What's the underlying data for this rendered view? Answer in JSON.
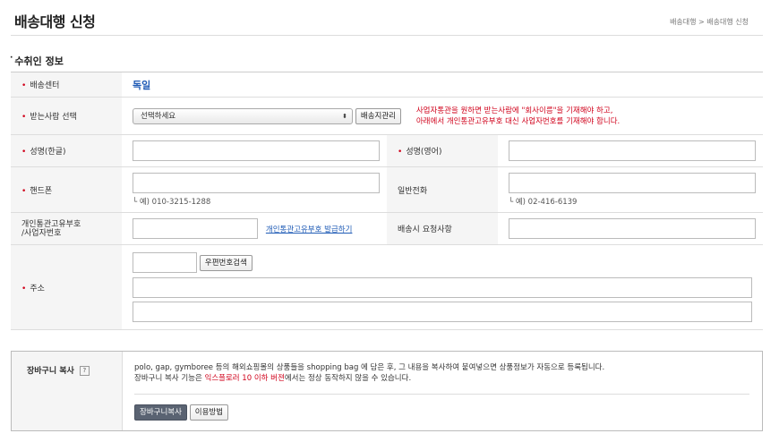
{
  "header": {
    "title": "배송대행 신청",
    "breadcrumb": "배송대행 > 배송대행 신청"
  },
  "recipient": {
    "section_title": "수취인 정보",
    "center_label": "배송센터",
    "center_value": "독일",
    "receiver_label": "받는사람 선택",
    "receiver_select_value": "선택하세요",
    "manage_button": "배송지관리",
    "warning_line1": "사업자통관을 원하면 받는사람에 \"회사이름\"을 기재해야 하고,",
    "warning_line2": "아래에서 개인통관고유부호 대신 사업자번호를 기재해야 합니다.",
    "name_kr_label": "성명(한글)",
    "name_kr_value": "",
    "name_en_label": "성명(영어)",
    "name_en_value": "",
    "mobile_label": "핸드폰",
    "mobile_value": "",
    "mobile_hint": "└ 예) 010-3215-1288",
    "phone_label": "일반전화",
    "phone_value": "",
    "phone_hint": "└ 예) 02-416-6139",
    "customs_label_line1": "개인통관고유부호",
    "customs_label_line2": "/사업자번호",
    "customs_value": "",
    "customs_link": "개인통관고유부호 발급하기",
    "request_label": "배송시 요청사항",
    "request_value": "",
    "address_label": "주소",
    "zipcode_value": "",
    "zipcode_button": "우편번호검색",
    "address1_value": "",
    "address2_value": ""
  },
  "cart_copy": {
    "label": "장바구니 복사",
    "help_icon_text": "?",
    "desc_line1": "polo, gap, gymboree 등의 해외쇼핑몰의 상품들을 shopping bag 에 담은 후, 그 내용을 복사하여 붙여넣으면 상품정보가 자동으로 등록됩니다.",
    "desc_line2_a": "장바구니 복사 기능은 ",
    "desc_line2_red": "익스플로러 10 이하 버젼",
    "desc_line2_b": "에서는 정상 동작하지 않을 수 있습니다.",
    "copy_button": "장바구니복사",
    "howto_button": "이용방법"
  },
  "colors": {
    "required": "#d0021b",
    "link": "#1f5bb6",
    "dark_button": "#5a6372"
  }
}
